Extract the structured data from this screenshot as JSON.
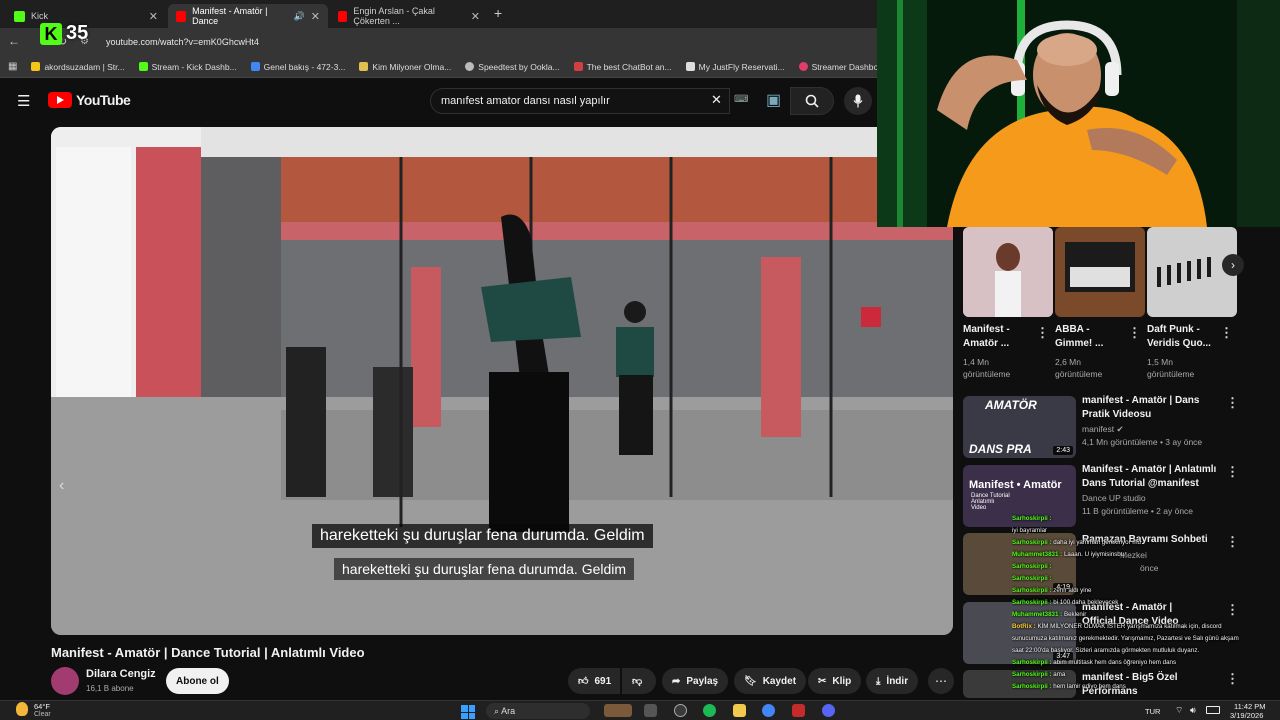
{
  "kick_counter": "35",
  "browser": {
    "tabs": [
      {
        "title": "Kick",
        "color": "#53fc18"
      },
      {
        "title": "Manifest - Amatör | Dance",
        "color": "#ff0000"
      },
      {
        "title": "Engin Arslan - Çakal Çökerten ...",
        "color": "#ff0000"
      }
    ],
    "new_tab": "+",
    "url": "youtube.com/watch?v=emK0GhcwHt4",
    "bookmarks": [
      {
        "label": "akordsuzadam | Str...",
        "color": "#f5c518"
      },
      {
        "label": "Stream - Kick Dashb...",
        "color": "#53fc18"
      },
      {
        "label": "Genel bakış - 472-3...",
        "color": "#4285f4"
      },
      {
        "label": "Kim Milyoner Olma...",
        "color": "#e0c050"
      },
      {
        "label": "Speedtest by Ookla...",
        "color": "#bbbbbb"
      },
      {
        "label": "The best ChatBot an...",
        "color": "#d04040"
      },
      {
        "label": "My JustFly Reservati...",
        "color": "#dddddd"
      },
      {
        "label": "Streamer Dashboard",
        "color": "#e23c6b"
      }
    ]
  },
  "youtube": {
    "logo_text": "YouTube",
    "search_query": "manıfest amator dansı nasıl yapılır",
    "video": {
      "subtitle_1": "hareketteki şu duruşlar fena durumda. Geldim",
      "subtitle_2": "hareketteki şu duruşlar fena durumda. Geldim",
      "title": "Manifest - Amatör | Dance Tutorial | Anlatımlı Video",
      "channel": "Dilara Cengiz",
      "subscribers": "16,1 B abone",
      "subscribe_label": "Abone ol",
      "likes": "691",
      "share_label": "Paylaş",
      "save_label": "Kaydet",
      "clip_label": "Klip",
      "download_label": "İndir"
    },
    "shorts": [
      {
        "title": "Manifest - Amatör ...",
        "views": "1,4 Mn görüntüleme",
        "color": "#c9a7a0"
      },
      {
        "title": "ABBA - Gimme! ...",
        "views": "2,6 Mn görüntüleme",
        "color": "#7a4a2a"
      },
      {
        "title": "Daft Punk - Veridis Quo...",
        "views": "1,5 Mn görüntüleme",
        "color": "#d9d9d9"
      }
    ],
    "recommendations": [
      {
        "title": "manifest - Amatör | Dans Pratik Videosu",
        "channel": "manifest",
        "meta": "4,1 Mn görüntüleme • 3 ay önce",
        "duration": "2:43",
        "thumb_text": "AMATÖR",
        "thumb_text2": "DANS PRA",
        "color": "#3a3a46"
      },
      {
        "title": "Manifest - Amatör | Anlatımlı Dans Tutorial @manifest",
        "channel": "Dance UP studio",
        "meta": "11 B görüntüleme • 2 ay önce",
        "duration": "",
        "thumb_text": "Manifest • Amatör",
        "thumb_text2": "Dance Tutorial Anlatımlı Video",
        "color": "#3b2f4a"
      },
      {
        "title": "Ramazan Bayramı Sohbeti",
        "channel": "Mezkei",
        "meta": "önce",
        "duration": "4:19",
        "thumb_text": "",
        "thumb_text2": "",
        "color": "#5a4a3a"
      },
      {
        "title": "manifest - Amatör | Official Dance Video",
        "channel": "",
        "meta": "",
        "duration": "3:47",
        "thumb_text": "",
        "thumb_text2": "",
        "color": "#4a4a52"
      },
      {
        "title": "manifest - Big5 Özel Performans",
        "channel": "",
        "meta": "",
        "duration": "",
        "thumb_text": "",
        "thumb_text2": "",
        "color": "#3a3a3a"
      }
    ]
  },
  "chat": [
    {
      "user": "Sarhoskirpii :",
      "msg": ""
    },
    {
      "user": "",
      "msg": "iyi bayramlar"
    },
    {
      "user": "Sarhoskirpii :",
      "msg": "daha iyi yamman gerekiriyor mu"
    },
    {
      "user": "Muhammet3831 :",
      "msg": "Laaan. U iyiymisinsbu"
    },
    {
      "user": "Sarhoskirpii :",
      "msg": ""
    },
    {
      "user": "Sarhoskirpii :",
      "msg": ""
    },
    {
      "user": "Sarhoskirpii :",
      "msg": "zehir aldı yine"
    },
    {
      "user": "Sarhoskirpii :",
      "msg": "bi 100 daha bekleyecek"
    },
    {
      "user": "Muhammet3831 :",
      "msg": "Beklenir"
    },
    {
      "user": "BotRix :",
      "msg": "KİM MİLYONER OLMAK İSTER yarışmamıza katılmak için, discord"
    },
    {
      "user": "",
      "msg": "sunucumuza katılmanız gerekmektedir. Yarışmamız, Pazartesi ve Salı günü akşam"
    },
    {
      "user": "",
      "msg": "saat 22:00'da başlıyor. Sizleri aramızda görmekten mutluluk duyarız."
    },
    {
      "user": "Sarhoskirpii :",
      "msg": "abim multitask hem dans öğreniyo hem dans"
    },
    {
      "user": "Sarhoskirpii :",
      "msg": "ama"
    },
    {
      "user": "Sarhoskirpii :",
      "msg": "hem lamir ediyo hem dans"
    }
  ],
  "taskbar": {
    "weather_temp": "64°F",
    "weather_desc": "Clear",
    "search_label": "Ara",
    "language": "TUR",
    "time": "11:42 PM",
    "date": "3/19/2026"
  }
}
